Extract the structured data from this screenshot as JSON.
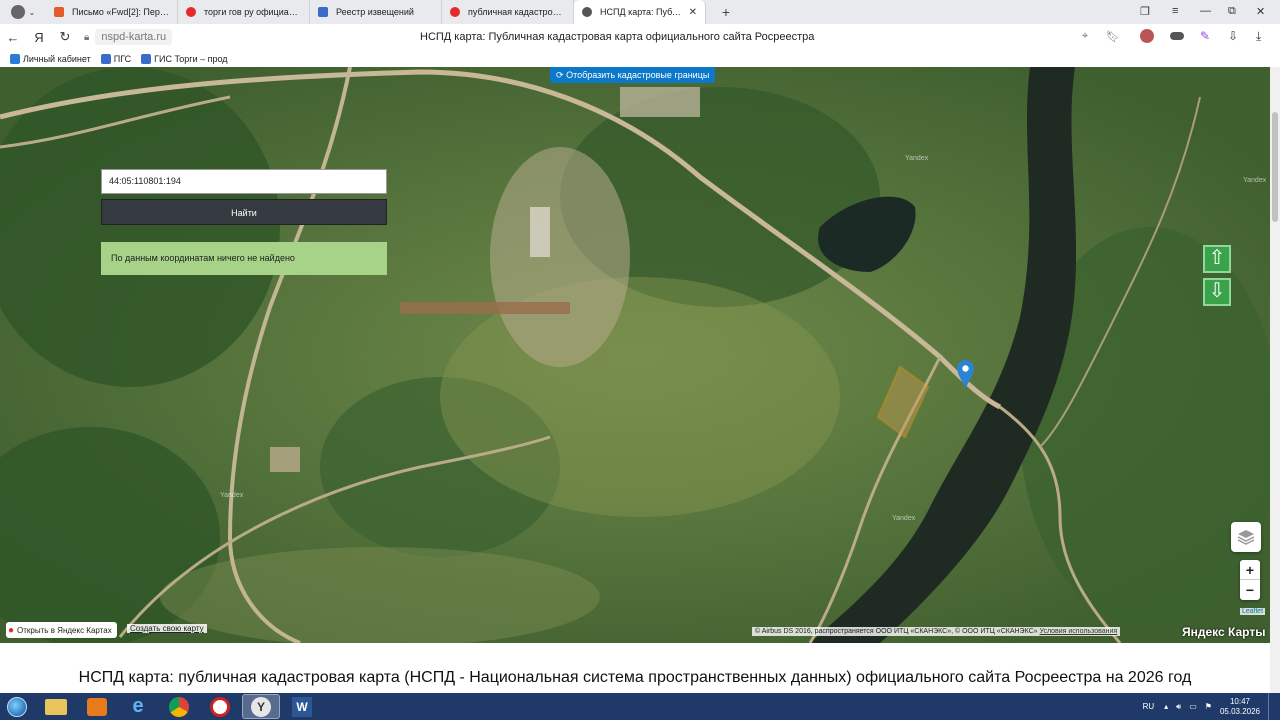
{
  "browser": {
    "tabs": [
      {
        "label": "Письмо «Fwd[2]: Перечен",
        "color": "#e55b2a"
      },
      {
        "label": "торги гов ру официальны",
        "color": "#e32b2b"
      },
      {
        "label": "Реестр извещений",
        "color": "#3a6bc9"
      },
      {
        "label": "публичная кадастровая к",
        "color": "#e32b2b"
      },
      {
        "label": "НСПД карта: Публична",
        "color": "#555555"
      }
    ],
    "address": "nspd-karta.ru",
    "page_title": "НСПД карта: Публичная кадастровая карта официального сайта Росреестра",
    "bookmarks": [
      "Личный кабинет",
      "ПГС",
      "ГИС Торги – прод"
    ]
  },
  "map": {
    "search_value": "44:05:110801:194",
    "search_button": "Найти",
    "result_message": "По данным координатам ничего не найдено",
    "cadastral_toggle": "Отобразить кадастровые границы",
    "zoom_in": "+",
    "zoom_out": "−",
    "leaflet_label": "Leaflet",
    "open_in_yandex": "Открыть в Яндекс Картах",
    "create_map": "Создать свою карту",
    "copyright": "© Airbus DS 2016, распространяется ООО ИТЦ «СКАНЭКС», © ООО ИТЦ «СКАНЭКС»",
    "terms": "Условия использования",
    "logo": "Яндекс Карты",
    "watermark": "Yandex"
  },
  "page": {
    "heading": "НСПД карта: публичная кадастровая карта (НСПД - Национальная система пространственных данных) официального сайта Росреестра на 2026 год"
  },
  "taskbar": {
    "lang": "RU",
    "time": "10:47",
    "date": "05.03.2026"
  }
}
